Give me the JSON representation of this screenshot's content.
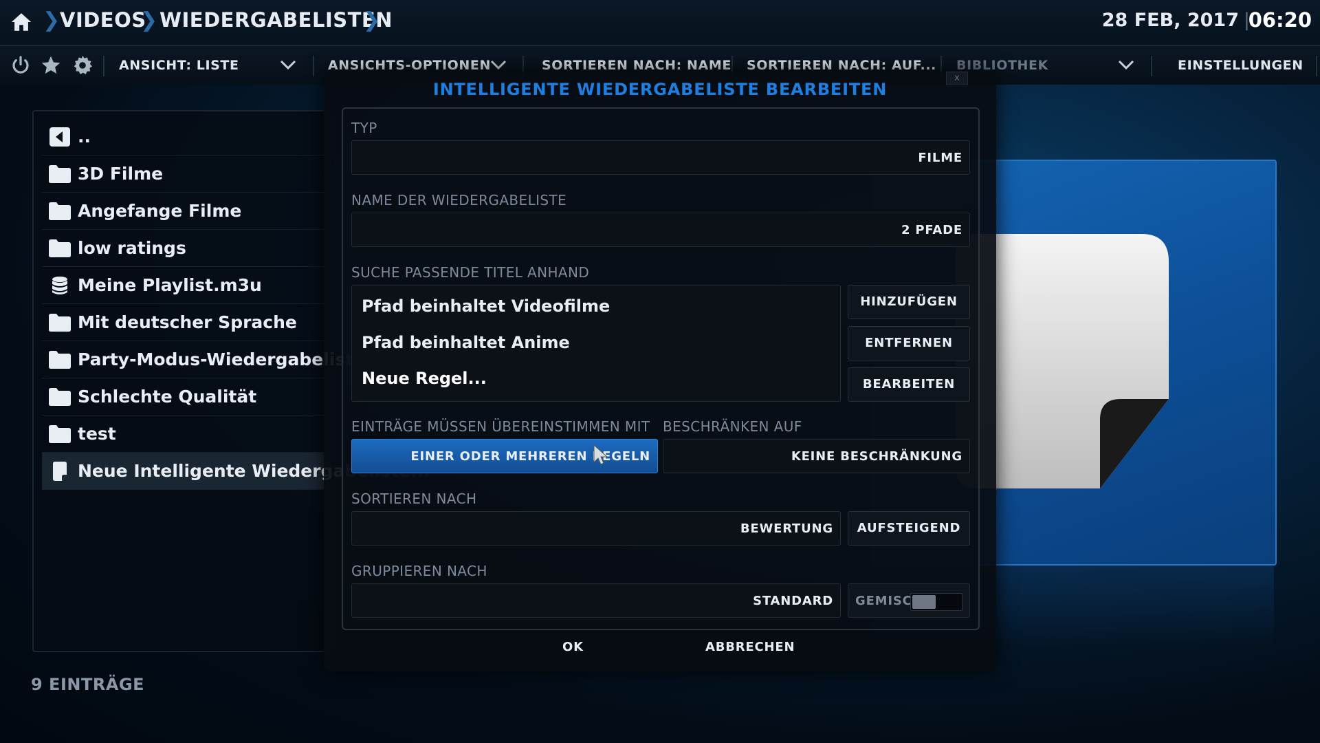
{
  "breadcrumb": {
    "items": [
      "VIDEOS",
      "WIEDERGABELISTEN"
    ]
  },
  "clock": {
    "date": "28 FEB, 2017",
    "separator": "|",
    "time": "06:20"
  },
  "toolbar": {
    "view_label": "ANSICHT: LISTE",
    "view_options_label": "ANSICHTS-OPTIONEN",
    "sort_by_label": "SORTIEREN NACH: NAME",
    "sort_order_label": "SORTIEREN NACH: AUF...",
    "library_label": "BIBLIOTHEK",
    "settings_label": "EINSTELLUNGEN"
  },
  "list": {
    "items": [
      {
        "label": "..",
        "icon": "back-icon"
      },
      {
        "label": "3D Filme",
        "icon": "folder-icon"
      },
      {
        "label": "Angefange Filme",
        "icon": "folder-icon"
      },
      {
        "label": "low ratings",
        "icon": "folder-icon"
      },
      {
        "label": "Meine Playlist.m3u",
        "icon": "playlist-icon"
      },
      {
        "label": "Mit deutscher Sprache",
        "icon": "folder-icon"
      },
      {
        "label": "Party-Modus-Wiedergabeliste",
        "icon": "folder-icon"
      },
      {
        "label": "Schlechte Qualität",
        "icon": "folder-icon"
      },
      {
        "label": "test",
        "icon": "folder-icon"
      },
      {
        "label": "Neue Intelligente Wiedergabeliste...",
        "icon": "document-icon"
      }
    ],
    "count_label": "9 EINTRÄGE"
  },
  "dialog": {
    "title": "INTELLIGENTE WIEDERGABELISTE BEARBEITEN",
    "close_label": "x",
    "type_label": "TYP",
    "type_value": "FILME",
    "name_label": "NAME DER WIEDERGABELISTE",
    "name_value": "2 PFADE",
    "rules_label": "SUCHE PASSENDE TITEL ANHAND",
    "rules": [
      "Pfad beinhaltet Videofilme",
      "Pfad beinhaltet Anime",
      "Neue Regel..."
    ],
    "add_label": "HINZUFÜGEN",
    "remove_label": "ENTFERNEN",
    "edit_label": "BEARBEITEN",
    "match_label": "EINTRÄGE MÜSSEN ÜBEREINSTIMMEN MIT",
    "match_value": "EINER ODER MEHREREN REGELN",
    "limit_label": "BESCHRÄNKEN AUF",
    "limit_value": "KEINE BESCHRÄNKUNG",
    "sort_label": "SORTIEREN NACH",
    "sort_value": "BEWERTUNG",
    "sort_direction": "AUFSTEIGEND",
    "group_label": "GRUPPIEREN NACH",
    "group_value": "STANDARD",
    "mixed_label": "GEMISCHT",
    "mixed_enabled": false,
    "ok_label": "OK",
    "cancel_label": "ABBRECHEN"
  },
  "colors": {
    "accent": "#1f7fe0",
    "active_field": "#1d6ac0",
    "thumb_panel": "#1565b4"
  }
}
